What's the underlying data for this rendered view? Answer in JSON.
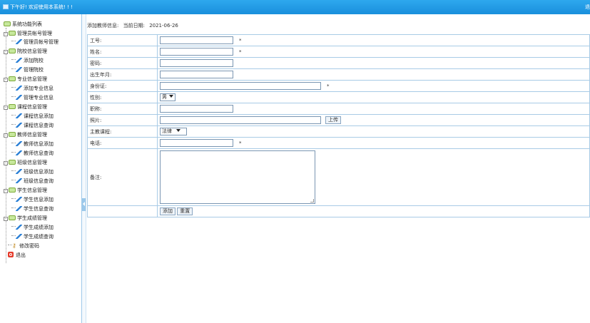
{
  "header": {
    "greeting": "下午好! 欢迎使用本系统! ! !",
    "exit_label": "退"
  },
  "sidebar": {
    "root_label": "系统功能列表",
    "groups": [
      {
        "label": "管理员帐号管理",
        "items": [
          "管理员帐号管理"
        ]
      },
      {
        "label": "院校信息管理",
        "items": [
          "添加院校",
          "管理院校"
        ]
      },
      {
        "label": "专业信息管理",
        "items": [
          "添加专业信息",
          "管理专业信息"
        ]
      },
      {
        "label": "课程信息管理",
        "items": [
          "课程信息添加",
          "课程信息查询"
        ]
      },
      {
        "label": "教师信息管理",
        "items": [
          "教师信息添加",
          "教师信息查询"
        ]
      },
      {
        "label": "班级信息管理",
        "items": [
          "班级信息添加",
          "班级信息查询"
        ]
      },
      {
        "label": "学生信息管理",
        "items": [
          "学生信息添加",
          "学生信息查询"
        ]
      },
      {
        "label": "学生成绩管理",
        "items": [
          "学生成绩添加",
          "学生成绩查询"
        ]
      }
    ],
    "change_password": "修改密码",
    "logout": "退出"
  },
  "page": {
    "title": "添加教师信息:",
    "date_label": "当前日期:",
    "date": "2021-06-26"
  },
  "form": {
    "fields": {
      "job_no": "工号:",
      "name": "姓名:",
      "password": "密码:",
      "birth": "出生年月:",
      "id_card": "身份证:",
      "gender": "性别:",
      "title": "职称:",
      "photo": "照片:",
      "course": "主教课程:",
      "phone": "电话:",
      "remark": "备注:"
    },
    "required_mark": "*",
    "gender_value": "男",
    "course_value": "法律",
    "upload_label": "上传",
    "add_label": "添加",
    "reset_label": "重置"
  }
}
